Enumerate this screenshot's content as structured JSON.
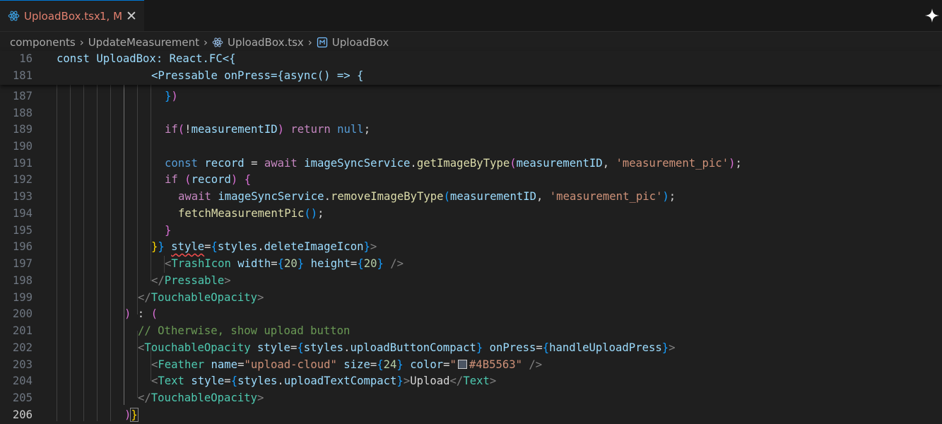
{
  "tab": {
    "filename": "UploadBox.tsx",
    "status": "1, M"
  },
  "breadcrumb": {
    "items": [
      "components",
      "UpdateMeasurement",
      "UploadBox.tsx",
      "UploadBox"
    ]
  },
  "sticky_lines": [
    {
      "number": "16",
      "code": "const UploadBox: React.FC<{"
    },
    {
      "number": "181",
      "code": "<Pressable onPress={async() => {"
    }
  ],
  "lines": [
    {
      "number": "187",
      "code": "})"
    },
    {
      "number": "188",
      "code": ""
    },
    {
      "number": "189",
      "code": "if(!measurementID) return null;"
    },
    {
      "number": "190",
      "code": ""
    },
    {
      "number": "191",
      "code": "const record = await imageSyncService.getImageByType(measurementID, 'measurement_pic');"
    },
    {
      "number": "192",
      "code": "if (record) {"
    },
    {
      "number": "193",
      "code": "await imageSyncService.removeImageByType(measurementID, 'measurement_pic');"
    },
    {
      "number": "194",
      "code": "fetchMeasurementPic();"
    },
    {
      "number": "195",
      "code": "}"
    },
    {
      "number": "196",
      "code": "}} style={styles.deleteImageIcon}>"
    },
    {
      "number": "197",
      "code": "<TrashIcon width={20} height={20} />"
    },
    {
      "number": "198",
      "code": "</Pressable>"
    },
    {
      "number": "199",
      "code": "</TouchableOpacity>"
    },
    {
      "number": "200",
      "code": ") : ("
    },
    {
      "number": "201",
      "code": "// Otherwise, show upload button"
    },
    {
      "number": "202",
      "code": "<TouchableOpacity style={styles.uploadButtonCompact} onPress={handleUploadPress}>"
    },
    {
      "number": "203",
      "code": "<Feather name=\"upload-cloud\" size={24} color=\"#4B5563\" />"
    },
    {
      "number": "204",
      "code": "<Text style={styles.uploadTextCompact}>Upload</Text>"
    },
    {
      "number": "205",
      "code": "</TouchableOpacity>"
    },
    {
      "number": "206",
      "code": ")}"
    }
  ],
  "active_line": "206",
  "colors": {
    "accent": "#0078d4",
    "modified_tab": "#e2806f",
    "editor_bg": "#1f1f1f"
  },
  "icons": {
    "tab_file": "react-icon",
    "close": "close-icon",
    "copilot": "sparkle-icon",
    "symbol": "symbol-method-icon"
  }
}
